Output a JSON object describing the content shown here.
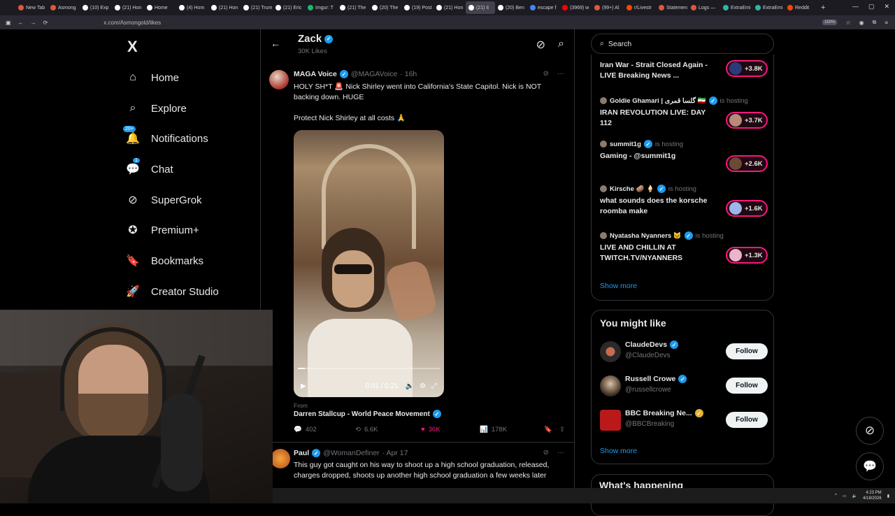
{
  "browser": {
    "tabs": [
      {
        "label": "New Tab",
        "color": "#e0563b"
      },
      {
        "label": "Asmong",
        "color": "#e0563b"
      },
      {
        "label": "(10) Exp",
        "color": "#ffffff"
      },
      {
        "label": "(21) Hon",
        "color": "#ffffff"
      },
      {
        "label": "Home",
        "color": "#ffffff"
      },
      {
        "label": "(4) Hom",
        "color": "#ffffff"
      },
      {
        "label": "(21) Hon",
        "color": "#ffffff"
      },
      {
        "label": "(21) Trum",
        "color": "#ffffff"
      },
      {
        "label": "(21) Eric",
        "color": "#ffffff"
      },
      {
        "label": "Imgur: T",
        "color": "#1bb76e"
      },
      {
        "label": "(21) The",
        "color": "#ffffff"
      },
      {
        "label": "(20) The",
        "color": "#ffffff"
      },
      {
        "label": "(19) Post",
        "color": "#ffffff"
      },
      {
        "label": "(21) Hon",
        "color": "#ffffff"
      },
      {
        "label": "(21) Ii",
        "color": "#ffffff"
      },
      {
        "label": "(20) Ben",
        "color": "#ffffff"
      },
      {
        "label": "escape f",
        "color": "#4285f4"
      },
      {
        "label": "(3969) w",
        "color": "#ff0000"
      },
      {
        "label": "(99+) Al",
        "color": "#e0563b"
      },
      {
        "label": "r/Livestr",
        "color": "#ff4500"
      },
      {
        "label": "Statemen",
        "color": "#e0563b"
      },
      {
        "label": "Logs —",
        "color": "#e0563b"
      },
      {
        "label": "ExtraEmi",
        "color": "#2fb5a3"
      },
      {
        "label": "ExtraEmi",
        "color": "#2fb5a3"
      },
      {
        "label": "Reddit",
        "color": "#ff4500"
      }
    ],
    "active_tab_index": 14,
    "url": "x.com/Asmongold/likes",
    "zoom": "150%"
  },
  "nav": {
    "logo": "X",
    "items": [
      {
        "label": "Home",
        "icon": "home-icon"
      },
      {
        "label": "Explore",
        "icon": "search-icon"
      },
      {
        "label": "Notifications",
        "icon": "bell-icon",
        "badge": "20+"
      },
      {
        "label": "Chat",
        "icon": "chat-icon",
        "badge": "1"
      },
      {
        "label": "SuperGrok",
        "icon": "grok-icon"
      },
      {
        "label": "Premium+",
        "icon": "verified-badge-icon"
      },
      {
        "label": "Bookmarks",
        "icon": "bookmark-icon"
      },
      {
        "label": "Creator Studio",
        "icon": "rocket-icon"
      }
    ]
  },
  "profile_header": {
    "name": "Zack",
    "subtitle": "30K Likes"
  },
  "tweet1": {
    "name": "MAGA Voice",
    "handle": "@MAGAVoice",
    "time": "· 16h",
    "text1": "HOLY SH*T 🚨 Nick Shirley went into California's State Capitol. Nick is NOT backing down. HUGE",
    "text2": "Protect Nick Shirley at all costs 🙏",
    "video_time": "0:01 / 0:21",
    "video_progress": 0.05,
    "from_label": "From",
    "from_name": "Darren Stallcup - World Peace Movement",
    "replies": "402",
    "reposts": "6.6K",
    "likes": "36K",
    "views": "178K",
    "like_color": "#f91880"
  },
  "tweet2": {
    "name": "Paul",
    "handle": "@WomanDefiner",
    "time": "· Apr 17",
    "text": "This guy got caught on his way to shoot up a high school graduation, released, charges dropped, shoots up another high school graduation a few weeks later"
  },
  "search": {
    "placeholder": "Search"
  },
  "live": {
    "items": [
      {
        "host": "",
        "host_suffix": "",
        "title": "Iran War - Strait Closed Again - LIVE Breaking News ...",
        "count": "+3.8K"
      },
      {
        "host": "Goldie Ghamari | گلسا قمری 🇮🇷",
        "host_suffix": "is hosting",
        "title": "IRAN REVOLUTION LIVE: DAY 112",
        "count": "+3.7K"
      },
      {
        "host": "summit1g",
        "host_suffix": "is hosting",
        "title": "Gaming - @summit1g",
        "count": "+2.6K"
      },
      {
        "host": "Kirsche 🥔 🍦",
        "host_suffix": "is hosting",
        "title": "what sounds does the korsche roomba make",
        "count": "+1.6K"
      },
      {
        "host": "Nyatasha Nyanners 🐱",
        "host_suffix": "is hosting",
        "title": "LIVE AND CHILLIN AT TWITCH.TV/NYANNERS",
        "count": "+1.3K"
      }
    ],
    "show_more": "Show more"
  },
  "you_might_like": {
    "title": "You might like",
    "users": [
      {
        "name": "ClaudeDevs",
        "handle": "@ClaudeDevs",
        "follow": "Follow"
      },
      {
        "name": "Russell Crowe",
        "handle": "@russellcrowe",
        "follow": "Follow"
      },
      {
        "name": "BBC Breaking Ne...",
        "handle": "@BBCBreaking",
        "follow": "Follow"
      }
    ],
    "show_more": "Show more"
  },
  "whats_happening": "What's happening",
  "taskbar": {
    "time": "4:23 PM",
    "date": "4/18/2026"
  }
}
